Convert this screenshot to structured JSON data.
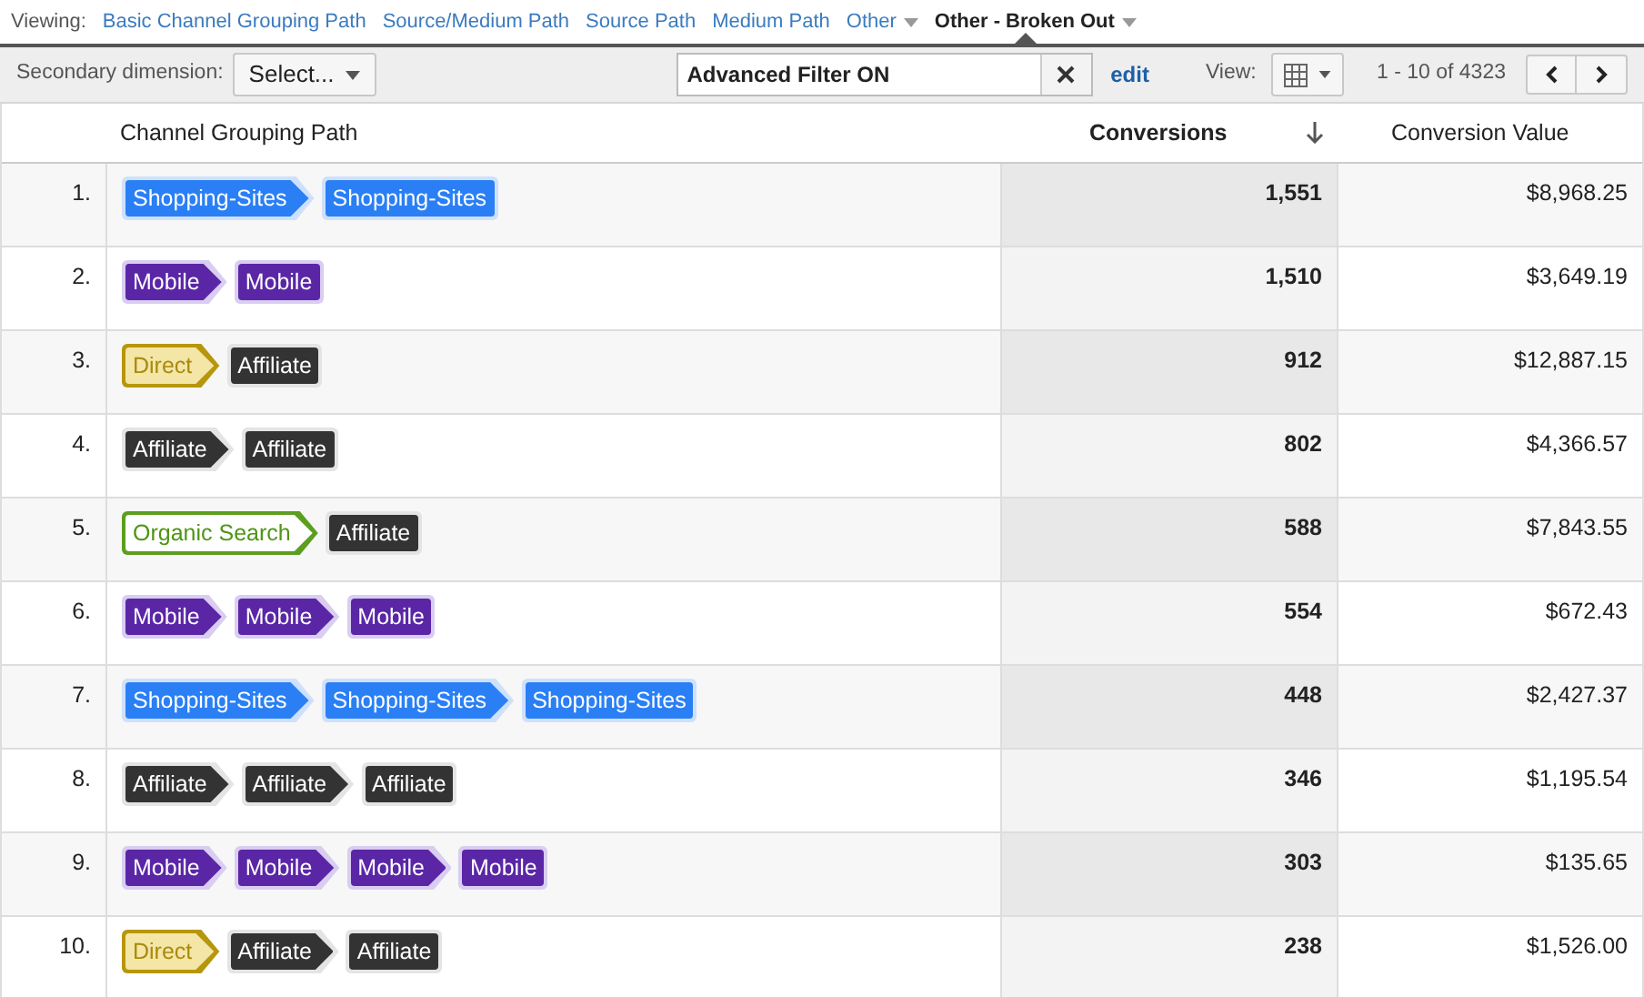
{
  "viewing": {
    "label": "Viewing:",
    "items": [
      {
        "label": "Basic Channel Grouping Path",
        "selected": false,
        "dropdown": false
      },
      {
        "label": "Source/Medium Path",
        "selected": false,
        "dropdown": false
      },
      {
        "label": "Source Path",
        "selected": false,
        "dropdown": false
      },
      {
        "label": "Medium Path",
        "selected": false,
        "dropdown": false
      },
      {
        "label": "Other",
        "selected": false,
        "dropdown": true
      },
      {
        "label": "Other - Broken Out",
        "selected": true,
        "dropdown": true
      }
    ]
  },
  "toolbar": {
    "secondary_label": "Secondary dimension:",
    "secondary_value": "Select...",
    "filter_value": "Advanced Filter ON",
    "edit_link": "edit",
    "view_label": "View:",
    "range": "1 - 10 of 4323"
  },
  "table": {
    "columns": [
      {
        "label": "Channel Grouping Path",
        "sorted": false
      },
      {
        "label": "Conversions",
        "sorted": true
      },
      {
        "label": "Conversion Value",
        "sorted": false
      }
    ],
    "rows": [
      {
        "index": "1.",
        "path": [
          {
            "kind": "shopping",
            "label": "Shopping-Sites"
          },
          {
            "kind": "shopping",
            "label": "Shopping-Sites"
          }
        ],
        "conversions": "1,551",
        "value": "$8,968.25"
      },
      {
        "index": "2.",
        "path": [
          {
            "kind": "mobile",
            "label": "Mobile"
          },
          {
            "kind": "mobile",
            "label": "Mobile"
          }
        ],
        "conversions": "1,510",
        "value": "$3,649.19"
      },
      {
        "index": "3.",
        "path": [
          {
            "kind": "direct",
            "label": "Direct"
          },
          {
            "kind": "affiliate",
            "label": "Affiliate"
          }
        ],
        "conversions": "912",
        "value": "$12,887.15"
      },
      {
        "index": "4.",
        "path": [
          {
            "kind": "affiliate",
            "label": "Affiliate"
          },
          {
            "kind": "affiliate",
            "label": "Affiliate"
          }
        ],
        "conversions": "802",
        "value": "$4,366.57"
      },
      {
        "index": "5.",
        "path": [
          {
            "kind": "organic",
            "label": "Organic Search"
          },
          {
            "kind": "affiliate",
            "label": "Affiliate"
          }
        ],
        "conversions": "588",
        "value": "$7,843.55"
      },
      {
        "index": "6.",
        "path": [
          {
            "kind": "mobile",
            "label": "Mobile"
          },
          {
            "kind": "mobile",
            "label": "Mobile"
          },
          {
            "kind": "mobile",
            "label": "Mobile"
          }
        ],
        "conversions": "554",
        "value": "$672.43"
      },
      {
        "index": "7.",
        "path": [
          {
            "kind": "shopping",
            "label": "Shopping-Sites"
          },
          {
            "kind": "shopping",
            "label": "Shopping-Sites"
          },
          {
            "kind": "shopping",
            "label": "Shopping-Sites"
          }
        ],
        "conversions": "448",
        "value": "$2,427.37"
      },
      {
        "index": "8.",
        "path": [
          {
            "kind": "affiliate",
            "label": "Affiliate"
          },
          {
            "kind": "affiliate",
            "label": "Affiliate"
          },
          {
            "kind": "affiliate",
            "label": "Affiliate"
          }
        ],
        "conversions": "346",
        "value": "$1,195.54"
      },
      {
        "index": "9.",
        "path": [
          {
            "kind": "mobile",
            "label": "Mobile"
          },
          {
            "kind": "mobile",
            "label": "Mobile"
          },
          {
            "kind": "mobile",
            "label": "Mobile"
          },
          {
            "kind": "mobile",
            "label": "Mobile"
          }
        ],
        "conversions": "303",
        "value": "$135.65"
      },
      {
        "index": "10.",
        "path": [
          {
            "kind": "direct",
            "label": "Direct"
          },
          {
            "kind": "affiliate",
            "label": "Affiliate"
          },
          {
            "kind": "affiliate",
            "label": "Affiliate"
          }
        ],
        "conversions": "238",
        "value": "$1,526.00"
      }
    ]
  }
}
